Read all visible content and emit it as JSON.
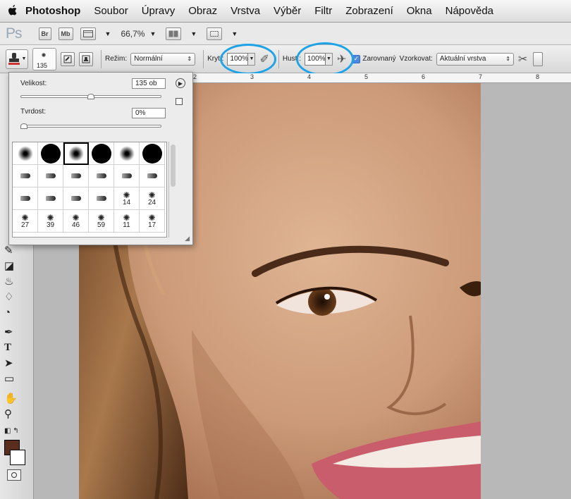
{
  "menubar": {
    "items": [
      "Photoshop",
      "Soubor",
      "Úpravy",
      "Obraz",
      "Vrstva",
      "Výběr",
      "Filtr",
      "Zobrazení",
      "Okna",
      "Nápověda"
    ]
  },
  "appbar": {
    "logo": "Ps",
    "bridge": "Br",
    "minibridge": "Mb",
    "zoom": "66,7%"
  },
  "options": {
    "brush_size": "135",
    "mode_label": "Režim:",
    "mode_value": "Normální",
    "opacity_label": "Krytí:",
    "opacity_value": "100%",
    "flow_label": "Hust.:",
    "flow_value": "100%",
    "aligned_label": "Zarovnaný",
    "aligned_checked": true,
    "sample_label": "Vzorkovat:",
    "sample_value": "Aktuální vrstva",
    "highlight_color": "#1fa3e6"
  },
  "rulers": {
    "ticks": [
      "2",
      "3",
      "4",
      "5",
      "6",
      "7",
      "8"
    ]
  },
  "brush_panel": {
    "size_label": "Velikost:",
    "size_value": "135 ob",
    "size_fraction": 0.5,
    "hardness_label": "Tvrdost:",
    "hardness_value": "0%",
    "hardness_fraction": 0.0,
    "presets": [
      {
        "kind": "soft",
        "num": ""
      },
      {
        "kind": "hard",
        "num": ""
      },
      {
        "kind": "soft",
        "num": "",
        "selected": true
      },
      {
        "kind": "hard",
        "num": ""
      },
      {
        "kind": "soft",
        "num": ""
      },
      {
        "kind": "hard",
        "num": ""
      },
      {
        "kind": "tip",
        "num": ""
      },
      {
        "kind": "tip",
        "num": ""
      },
      {
        "kind": "tip",
        "num": ""
      },
      {
        "kind": "tip",
        "num": ""
      },
      {
        "kind": "tip",
        "num": ""
      },
      {
        "kind": "tip",
        "num": ""
      },
      {
        "kind": "tip",
        "num": ""
      },
      {
        "kind": "tip",
        "num": ""
      },
      {
        "kind": "tip",
        "num": ""
      },
      {
        "kind": "tip",
        "num": ""
      },
      {
        "kind": "scatter",
        "num": "14"
      },
      {
        "kind": "scatter",
        "num": "24"
      },
      {
        "kind": "scatter",
        "num": "27"
      },
      {
        "kind": "scatter",
        "num": "39"
      },
      {
        "kind": "scatter",
        "num": "46"
      },
      {
        "kind": "scatter",
        "num": "59"
      },
      {
        "kind": "scatter",
        "num": "11"
      },
      {
        "kind": "scatter",
        "num": "17"
      }
    ]
  },
  "colors": {
    "foreground": "#5a2d1c",
    "background": "#ffffff"
  }
}
